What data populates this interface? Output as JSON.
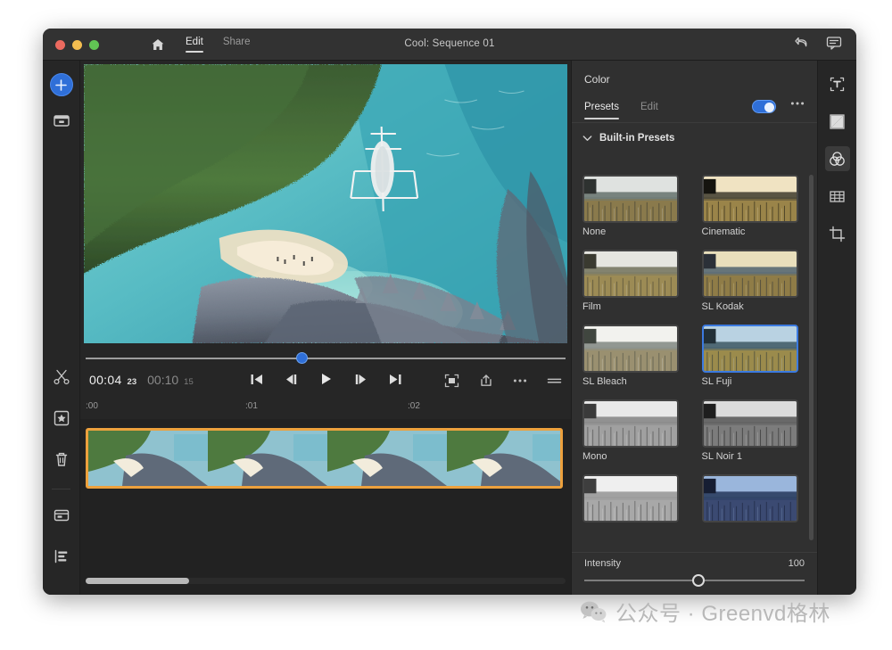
{
  "titlebar": {
    "home_icon": "home-icon",
    "tabs": [
      {
        "label": "Edit",
        "active": true
      },
      {
        "label": "Share",
        "active": false
      }
    ],
    "title": "Cool: Sequence 01",
    "undo_icon": "undo-icon",
    "comments_icon": "comment-icon"
  },
  "left_rail": {
    "add_label": "+",
    "items": [
      {
        "name": "add-media-button",
        "icon": "plus-circle-icon"
      },
      {
        "name": "media-browser-button",
        "icon": "media-box-icon"
      },
      {
        "name": "split-clip-button",
        "icon": "scissors-icon"
      },
      {
        "name": "add-effect-button",
        "icon": "card-star-icon"
      },
      {
        "name": "delete-button",
        "icon": "trash-icon"
      },
      {
        "name": "captions-button",
        "icon": "caption-card-icon"
      },
      {
        "name": "properties-button",
        "icon": "list-align-icon"
      }
    ]
  },
  "right_rail": {
    "items": [
      {
        "name": "text-tool",
        "icon": "text-box-icon",
        "active": false
      },
      {
        "name": "transitions-tool",
        "icon": "transition-bowtie-icon",
        "active": false
      },
      {
        "name": "color-tool",
        "icon": "color-circles-icon",
        "active": true
      },
      {
        "name": "effects-tool",
        "icon": "effects-grid-icon",
        "active": false
      },
      {
        "name": "crop-tool",
        "icon": "crop-transform-icon",
        "active": false
      }
    ]
  },
  "player": {
    "scrubber_percent": 45,
    "current_time": "00:04",
    "current_frames": "23",
    "total_time": "00:10",
    "total_frames": "15",
    "transport": [
      {
        "name": "go-to-start-button",
        "icon": "skip-start-icon"
      },
      {
        "name": "step-back-button",
        "icon": "step-back-icon"
      },
      {
        "name": "play-button",
        "icon": "play-icon"
      },
      {
        "name": "step-forward-button",
        "icon": "step-forward-icon"
      },
      {
        "name": "go-to-end-button",
        "icon": "skip-end-icon"
      }
    ],
    "right_tools": [
      {
        "name": "fit-to-screen-button",
        "icon": "fit-screen-icon"
      },
      {
        "name": "export-frame-button",
        "icon": "export-icon"
      },
      {
        "name": "more-options-button",
        "icon": "ellipsis-icon"
      },
      {
        "name": "player-settings-button",
        "icon": "equals-icon"
      }
    ]
  },
  "timeline": {
    "ruler_labels": [
      {
        "text": ":00",
        "left_pct": 0
      },
      {
        "text": ":01",
        "left_pct": 33
      },
      {
        "text": ":02",
        "left_pct": 66
      }
    ],
    "clip_name": "video-clip",
    "scrollbar_width_pct": 21
  },
  "color_panel": {
    "title": "Color",
    "tabs": [
      {
        "label": "Presets",
        "active": true
      },
      {
        "label": "Edit",
        "active": false
      }
    ],
    "toggle_on": true,
    "toggle_color": "#2f6fd8",
    "more_icon": "ellipsis-icon",
    "section": {
      "chevron": "chevron-down-icon",
      "label": "Built-in Presets"
    },
    "presets": [
      {
        "label": "None",
        "selected": false,
        "style": "none"
      },
      {
        "label": "Cinematic",
        "selected": false,
        "style": "cinematic"
      },
      {
        "label": "Film",
        "selected": false,
        "style": "film"
      },
      {
        "label": "SL Kodak",
        "selected": false,
        "style": "kodak"
      },
      {
        "label": "SL Bleach",
        "selected": false,
        "style": "bleach"
      },
      {
        "label": "SL Fuji",
        "selected": true,
        "style": "fuji"
      },
      {
        "label": "Mono",
        "selected": false,
        "style": "mono"
      },
      {
        "label": "SL Noir 1",
        "selected": false,
        "style": "noir"
      },
      {
        "label": "",
        "selected": false,
        "style": "mono2"
      },
      {
        "label": "",
        "selected": false,
        "style": "blue"
      }
    ],
    "intensity": {
      "label": "Intensity",
      "value": "100",
      "handle_percent": 52
    }
  },
  "watermark": {
    "icon": "wechat-icon",
    "text": "公众号 · Greenvd格林"
  }
}
